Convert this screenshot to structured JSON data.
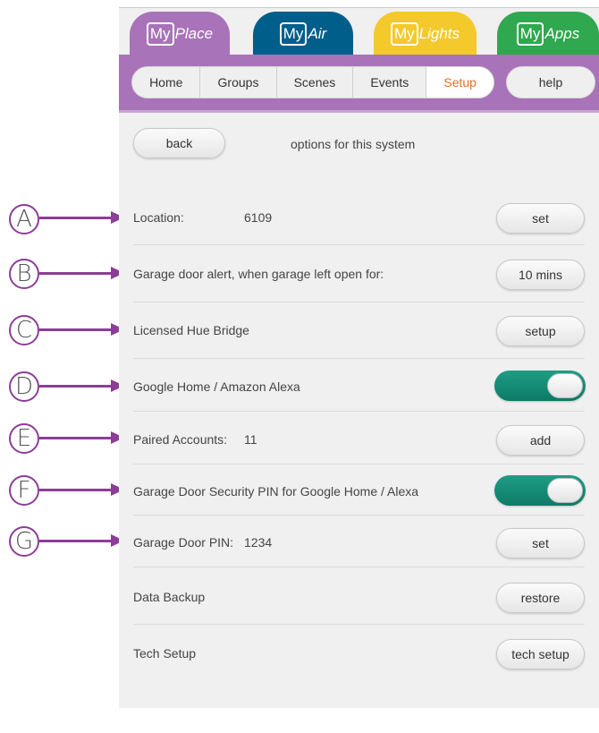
{
  "apps": [
    {
      "my": "My",
      "name": "Place"
    },
    {
      "my": "My",
      "name": "Air"
    },
    {
      "my": "My",
      "name": "Lights"
    },
    {
      "my": "My",
      "name": "Apps"
    }
  ],
  "nav": {
    "items": [
      "Home",
      "Groups",
      "Scenes",
      "Events",
      "Setup"
    ],
    "active": "Setup",
    "help": "help"
  },
  "header": {
    "back": "back",
    "title": "options for this system"
  },
  "settings": {
    "location": {
      "label": "Location:",
      "value": "6109",
      "button": "set"
    },
    "garage_alert": {
      "label": "Garage door alert, when garage left open for:",
      "button": "10 mins"
    },
    "hue": {
      "label": "Licensed Hue Bridge",
      "button": "setup"
    },
    "assistants": {
      "label": "Google Home / Amazon Alexa",
      "toggle_on": true
    },
    "paired": {
      "label": "Paired Accounts:",
      "value": "11",
      "button": "add"
    },
    "security_pin": {
      "label": "Garage Door Security PIN for Google Home / Alexa",
      "toggle_on": true
    },
    "door_pin": {
      "label": "Garage Door PIN:",
      "value": "1234",
      "button": "set"
    },
    "backup": {
      "label": "Data Backup",
      "button": "restore"
    },
    "tech": {
      "label": "Tech Setup",
      "button": "tech setup"
    }
  },
  "callouts": [
    "A",
    "B",
    "C",
    "D",
    "E",
    "F",
    "G"
  ],
  "colors": {
    "myplace": "#a873b8",
    "myair": "#005e8a",
    "mylights": "#f4c92c",
    "myapps": "#2fa84f",
    "active_nav_text": "#e2722a",
    "toggle_on": "#0d7a66",
    "callout": "#8c3e97"
  }
}
